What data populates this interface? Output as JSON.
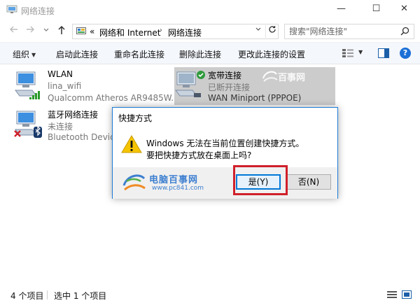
{
  "window": {
    "title": "网络连接",
    "minimize": "—",
    "maximize": "☐",
    "close": "✕"
  },
  "address": {
    "overflow": "«",
    "crumbs": [
      "网络和 Internet",
      "网络连接"
    ],
    "separator": "›",
    "search_placeholder": "搜索\"网络连接\""
  },
  "toolbar": {
    "organize": "组织",
    "enable": "启动此连接",
    "rename": "重命名此连接",
    "delete": "删除此连接",
    "change_settings": "更改此连接的设置"
  },
  "connections": [
    {
      "name": "WLAN",
      "status": "lina_wifi",
      "device": "Qualcomm Atheros AR9485W...",
      "icon": "wifi-adapter-icon"
    },
    {
      "name": "宽带连接",
      "status": "已断开连接",
      "device": "WAN Miniport (PPPOE)",
      "icon": "broadband-adapter-icon"
    },
    {
      "name": "蓝牙网络连接",
      "status": "未连接",
      "device": "Bluetooth Device",
      "icon": "bluetooth-adapter-icon"
    }
  ],
  "dialog": {
    "title": "快捷方式",
    "line1": "Windows 无法在当前位置创建快捷方式。",
    "line2": "要把快捷方式放在桌面上吗?",
    "yes": "是(Y)",
    "no": "否(N)",
    "watermark_name": "电脑百事网",
    "watermark_url": "www.pc841.com",
    "watermark_top": "百事网"
  },
  "status": {
    "item_count": "4 个项目",
    "selected": "选中 1 个项目"
  },
  "colors": {
    "accent": "#0078d7",
    "highlight_border": "#d0202a",
    "selection_bg": "#cccccc"
  }
}
